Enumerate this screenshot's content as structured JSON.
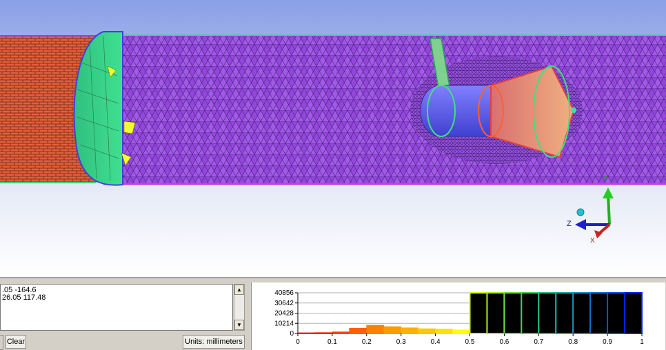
{
  "console": {
    "lines": [
      ".05 -164.6",
      "26.05 117.48"
    ]
  },
  "buttons": {
    "clear": "Clear",
    "units": "Units: millimeters"
  },
  "triad": {
    "y_label": "Y",
    "z_label": "Z",
    "x_label": "X"
  },
  "chart_data": {
    "type": "bar",
    "x_ticks": [
      "0",
      "0.1",
      "0.2",
      "0.3",
      "0.4",
      "0.5",
      "0.6",
      "0.7",
      "0.8",
      "0.9",
      "1"
    ],
    "y_ticks": [
      "40856",
      "30642",
      "20428",
      "10214",
      "0"
    ],
    "xlim": [
      0,
      1
    ],
    "ylim": [
      0,
      40856
    ],
    "bins": [
      {
        "x0": 0.0,
        "x1": 0.05,
        "value": 600,
        "color": "#ff0000"
      },
      {
        "x0": 0.05,
        "x1": 0.1,
        "value": 800,
        "color": "#ff2000"
      },
      {
        "x0": 0.1,
        "x1": 0.15,
        "value": 1500,
        "color": "#ff4000"
      },
      {
        "x0": 0.15,
        "x1": 0.2,
        "value": 5200,
        "color": "#ff6000"
      },
      {
        "x0": 0.2,
        "x1": 0.25,
        "value": 8200,
        "color": "#ff8000"
      },
      {
        "x0": 0.25,
        "x1": 0.3,
        "value": 6800,
        "color": "#ff9a00"
      },
      {
        "x0": 0.3,
        "x1": 0.35,
        "value": 5600,
        "color": "#ffb000"
      },
      {
        "x0": 0.35,
        "x1": 0.4,
        "value": 4700,
        "color": "#ffc800"
      },
      {
        "x0": 0.4,
        "x1": 0.45,
        "value": 4300,
        "color": "#ffe000"
      },
      {
        "x0": 0.45,
        "x1": 0.5,
        "value": 3500,
        "color": "#ffff00"
      },
      {
        "x0": 0.5,
        "x1": 0.55,
        "value": 40856,
        "color": "#d0ff00"
      },
      {
        "x0": 0.55,
        "x1": 0.6,
        "value": 40856,
        "color": "#a0f020"
      },
      {
        "x0": 0.6,
        "x1": 0.65,
        "value": 40856,
        "color": "#70e040"
      },
      {
        "x0": 0.65,
        "x1": 0.7,
        "value": 40856,
        "color": "#40d060"
      },
      {
        "x0": 0.7,
        "x1": 0.75,
        "value": 40856,
        "color": "#20c080"
      },
      {
        "x0": 0.75,
        "x1": 0.8,
        "value": 40856,
        "color": "#10b0a0"
      },
      {
        "x0": 0.8,
        "x1": 0.85,
        "value": 40856,
        "color": "#1090c0"
      },
      {
        "x0": 0.85,
        "x1": 0.9,
        "value": 40856,
        "color": "#1070d0"
      },
      {
        "x0": 0.9,
        "x1": 0.95,
        "value": 40856,
        "color": "#1050e0"
      },
      {
        "x0": 0.95,
        "x1": 1.0,
        "value": 40856,
        "color": "#0020ff"
      }
    ]
  }
}
